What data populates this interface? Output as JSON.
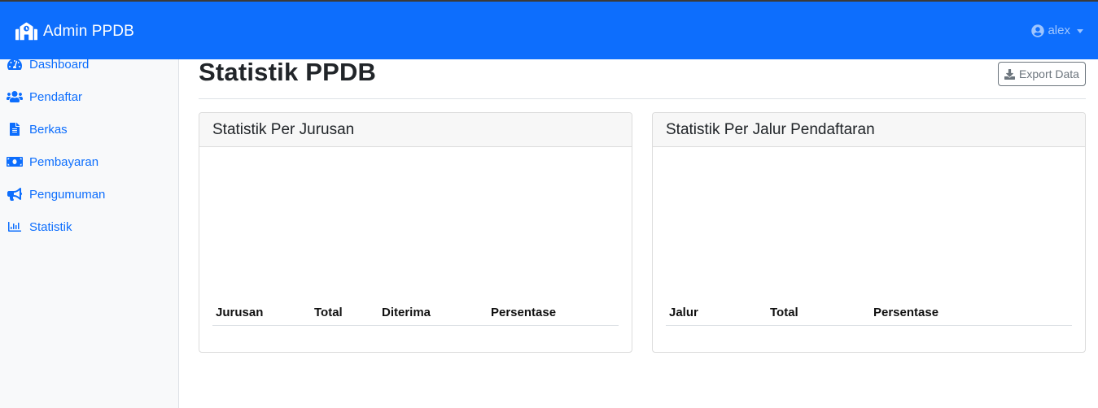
{
  "navbar": {
    "brand": "Admin PPDB",
    "user": "alex",
    "accent": "#0d6efd"
  },
  "sidebar": {
    "items": [
      {
        "label": "Dashboard",
        "icon": "tachometer-icon"
      },
      {
        "label": "Pendaftar",
        "icon": "users-icon"
      },
      {
        "label": "Berkas",
        "icon": "file-icon"
      },
      {
        "label": "Pembayaran",
        "icon": "money-bill-icon"
      },
      {
        "label": "Pengumuman",
        "icon": "bullhorn-icon"
      },
      {
        "label": "Statistik",
        "icon": "chart-bar-icon"
      }
    ]
  },
  "main": {
    "title": "Statistik PPDB",
    "export_label": "Export Data",
    "cards": [
      {
        "title": "Statistik Per Jurusan",
        "columns": [
          "Jurusan",
          "Total",
          "Diterima",
          "Persentase"
        ]
      },
      {
        "title": "Statistik Per Jalur Pendaftaran",
        "columns": [
          "Jalur",
          "Total",
          "Persentase"
        ]
      }
    ]
  }
}
